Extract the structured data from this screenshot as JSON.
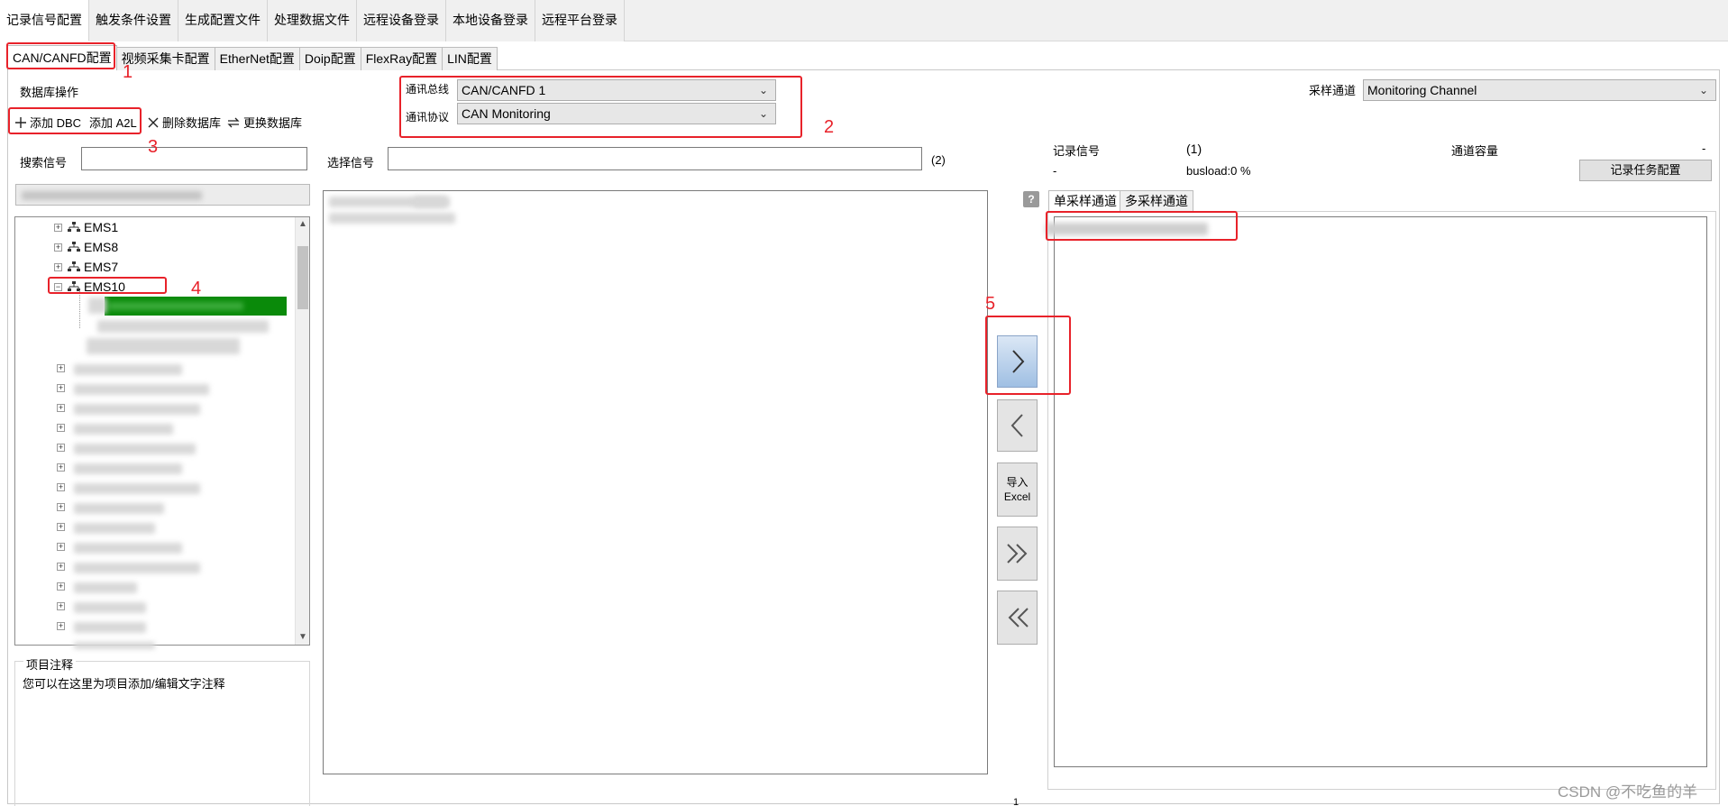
{
  "top_tabs": [
    "记录信号配置",
    "触发条件设置",
    "生成配置文件",
    "处理数据文件",
    "远程设备登录",
    "本地设备登录",
    "远程平台登录"
  ],
  "sub_tabs": [
    "CAN/CANFD配置",
    "视频采集卡配置",
    "EtherNet配置",
    "Doip配置",
    "FlexRay配置",
    "LIN配置"
  ],
  "db": {
    "title": "数据库操作",
    "add_dbc": "添加 DBC",
    "add_a2l": "添加 A2L",
    "delete_db": "删除数据库",
    "replace_db": "更换数据库"
  },
  "bus": {
    "bus_label": "通讯总线",
    "bus_value": "CAN/CANFD 1",
    "protocol_label": "通讯协议",
    "protocol_value": "CAN Monitoring"
  },
  "sample_channel": {
    "label": "采样通道",
    "value": "Monitoring Channel"
  },
  "search_label": "搜索信号",
  "select_label": "选择信号",
  "select_count": "(2)",
  "tree_nodes": [
    "EMS1",
    "EMS8",
    "EMS7",
    "EMS10"
  ],
  "notes": {
    "title": "项目注释",
    "text": "您可以在这里为项目添加/编辑文字注释"
  },
  "right_info": {
    "record_label": "记录信号",
    "record_count": "(1)",
    "capacity_label": "通道容量",
    "capacity_value": "-",
    "dash": "-",
    "busload": "busload:0 %",
    "task_btn": "记录任务配置"
  },
  "right_tabs": [
    "单采样通道",
    "多采样通道"
  ],
  "help_icon": "?",
  "mid_buttons": {
    "import_line1": "导入",
    "import_line2": "Excel"
  },
  "annotations": [
    "1",
    "2",
    "3",
    "4",
    "5"
  ],
  "watermark": "CSDN @不吃鱼的羊",
  "bottom_mark": "1",
  "colors": {
    "annotation": "#e8222a",
    "selected_node": "#0a8a0a"
  }
}
